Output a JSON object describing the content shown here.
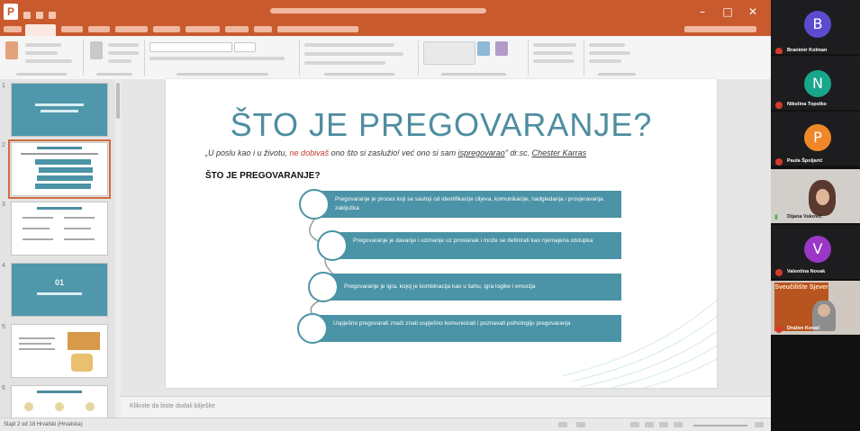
{
  "app": {
    "logo_letter": "P",
    "accent_color": "#c85a2e"
  },
  "slides_panel": {
    "items": [
      {
        "num": "1",
        "kind": "title-slide"
      },
      {
        "num": "2",
        "kind": "current-slide",
        "selected": true
      },
      {
        "num": "3",
        "kind": "text-slide"
      },
      {
        "num": "4",
        "kind": "section-slide",
        "big_number": "01"
      },
      {
        "num": "5",
        "kind": "image-slide"
      },
      {
        "num": "6",
        "kind": "text-slide"
      }
    ]
  },
  "slide": {
    "title": "ŠTO JE PREGOVARANJE?",
    "quote_start": "„U poslu kao i u životu, ",
    "quote_red": "ne dobivaš",
    "quote_mid": " ono što si zaslužio! već ono si sam ",
    "quote_underlined": "ispregovarao",
    "quote_end": "\" dr.sc. ",
    "quote_author": "Chester Karras",
    "subtitle": "ŠTO JE PREGOVARANJE?",
    "items": [
      "Pregovaranje je proces koji se sastoji od identifikacije ciljeva, komunikacije, nadgledanja i provjeravanja zaključka",
      "Pregovaranje je davanje i uzimanje uz proslanak i može se definirati kao njemajena otstupka",
      "Pregovaranje je igra, kojoj je kombinacija kao u šahu, igra logike i emocija",
      "Uspješno pregovarati znači znati uspješno komunicirati i poznavati psihologiju pregovaranja"
    ],
    "accent_color": "#4b93a6",
    "title_color": "#4e8da0"
  },
  "notes": {
    "placeholder": "Kliknite da biste dodali bilješke"
  },
  "statusbar": {
    "left": "Slajd 2 od 18    Hrvatski (Hrvatska)"
  },
  "participants": [
    {
      "initial": "B",
      "name": "Branimir Kolman",
      "avatar_color": "#5b4ccf",
      "muted": true
    },
    {
      "initial": "N",
      "name": "Nikolina Topolko",
      "avatar_color": "#19a78c",
      "muted": true
    },
    {
      "initial": "P",
      "name": "Paula Špoljarić",
      "avatar_color": "#f0882a",
      "muted": true
    },
    {
      "name": "Dijana Vuković",
      "video": true,
      "muted": false
    },
    {
      "initial": "V",
      "name": "Valentina Novak",
      "avatar_color": "#9b37c6",
      "muted": true
    },
    {
      "name": "Dražen Kovač",
      "video": true,
      "muted": true,
      "poster_text": "Sveučilište Sjever"
    }
  ]
}
